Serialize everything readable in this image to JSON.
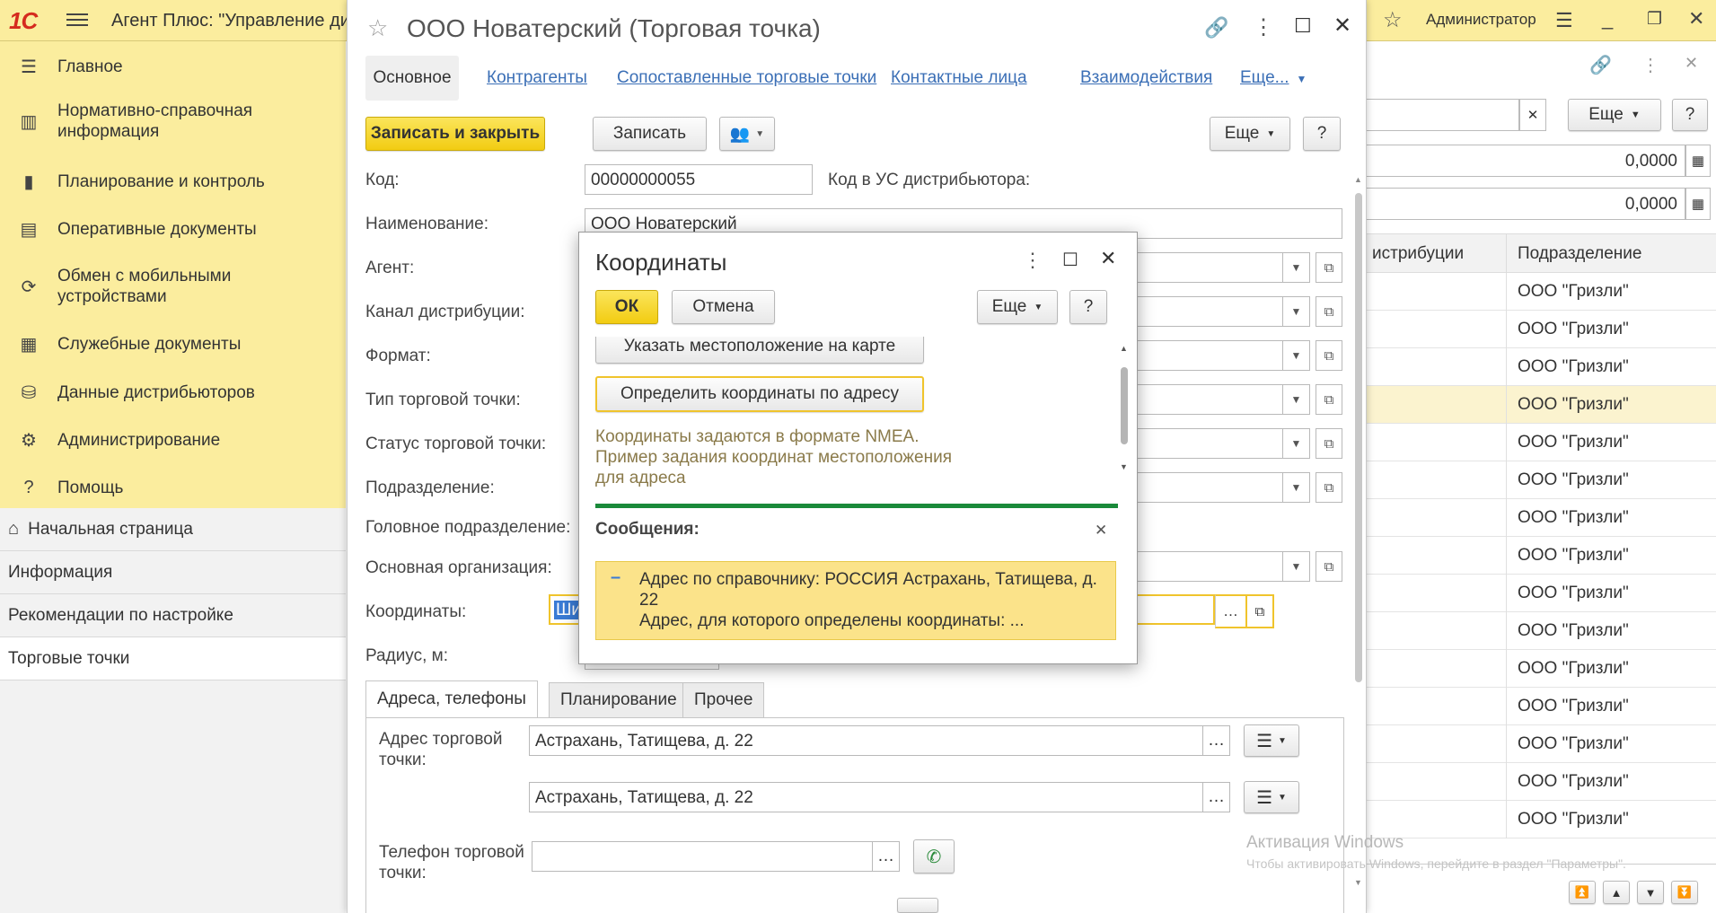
{
  "app": {
    "title": "Агент Плюс: \"Управление ди",
    "logo": "1С",
    "user": "Администратор"
  },
  "sidebar": {
    "items": [
      {
        "label": "Главное",
        "icon": "menu-lines-icon"
      },
      {
        "label": "Нормативно-справочная информация",
        "icon": "books-icon"
      },
      {
        "label": "Планирование и контроль",
        "icon": "bar-chart-icon"
      },
      {
        "label": "Оперативные документы",
        "icon": "documents-icon"
      },
      {
        "label": "Обмен с мобильными устройствами",
        "icon": "sync-icon"
      },
      {
        "label": "Служебные документы",
        "icon": "service-docs-icon"
      },
      {
        "label": "Данные дистрибьюторов",
        "icon": "database-icon"
      },
      {
        "label": "Администрирование",
        "icon": "gear-icon"
      },
      {
        "label": "Помощь",
        "icon": "question-icon"
      }
    ]
  },
  "secnav": {
    "items": [
      "Начальная страница",
      "Информация",
      "Рекомендации по настройке",
      "Торговые точки"
    ]
  },
  "form": {
    "title": "ООО Новатерский (Торговая точка)",
    "tabs": [
      "Основное",
      "Контрагенты",
      "Сопоставленные торговые точки",
      "Контактные лица",
      "Взаимодействия",
      "Еще..."
    ],
    "buttons": {
      "save_close": "Записать и закрыть",
      "save": "Записать",
      "more": "Еще",
      "help": "?"
    },
    "fields": {
      "code_label": "Код:",
      "code_value": "00000000055",
      "code_us_label": "Код в УС дистрибьютора:",
      "name_label": "Наименование:",
      "name_value": "ООО Новатерский",
      "agent_label": "Агент:",
      "channel_label": "Канал дистрибуции:",
      "format_label": "Формат:",
      "type_label": "Тип торговой точки:",
      "status_label": "Статус торговой точки:",
      "division_label": "Подразделение:",
      "head_division_label": "Головное подразделение:",
      "main_org_label": "Основная организация:",
      "coords_label": "Координаты:",
      "coords_value": "Ши",
      "radius_label": "Радиус, м:"
    },
    "subtabs": [
      "Адреса, телефоны",
      "Планирование",
      "Прочее"
    ],
    "address": {
      "label": "Адрес торговой точки:",
      "value1": "Астрахань, Татищева, д. 22",
      "value2": "Астрахань, Татищева, д. 22",
      "phone_label": "Телефон торговой точки:",
      "phone_value": ""
    }
  },
  "dialog": {
    "title": "Координаты",
    "ok": "ОК",
    "cancel": "Отмена",
    "more": "Еще",
    "help": "?",
    "map_button": "Указать местоположение на карте",
    "address_button": "Определить координаты по адресу",
    "hint": "Координаты задаются в формате NMEA. Пример задания координат местоположения для адреса",
    "messages_title": "Сообщения:",
    "message_line1": "Адрес по справочнику: РОССИЯ Астрахань, Татищева, д. 22",
    "message_line2": "Адрес, для которого определены координаты: ..."
  },
  "background_list": {
    "more": "Еще",
    "help": "?",
    "value1": "0,0000",
    "value2": "0,0000",
    "col_left": "истрибуции",
    "col_right": "Подразделение",
    "rows": [
      "ООО \"Гризли\"",
      "ООО \"Гризли\"",
      "ООО \"Гризли\"",
      "ООО \"Гризли\"",
      "ООО \"Гризли\"",
      "ООО \"Гризли\"",
      "ООО \"Гризли\"",
      "ООО \"Гризли\"",
      "ООО \"Гризли\"",
      "ООО \"Гризли\"",
      "ООО \"Гризли\"",
      "ООО \"Гризли\"",
      "ООО \"Гризли\"",
      "ООО \"Гризли\"",
      "ООО \"Гризли\""
    ]
  },
  "watermark": {
    "line1": "Активация Windows",
    "line2": "Чтобы активировать Windows, перейдите в раздел \"Параметры\"."
  }
}
